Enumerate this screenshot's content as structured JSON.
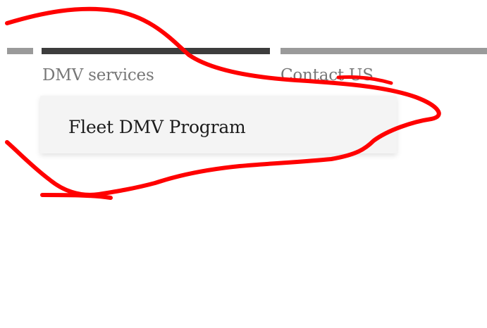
{
  "nav": {
    "items": [
      {
        "label": "DMV services"
      },
      {
        "label": "Contact US"
      }
    ],
    "active_index": 0
  },
  "dropdown": {
    "items": [
      {
        "label": "Fleet DMV Program"
      }
    ]
  },
  "colors": {
    "bar_active": "#3d3d3d",
    "bar_inactive": "#9a9a9a",
    "nav_text": "#777777",
    "menu_background": "#f4f4f4",
    "menu_text": "#1c1c1c",
    "annotation": "#ff0000"
  }
}
